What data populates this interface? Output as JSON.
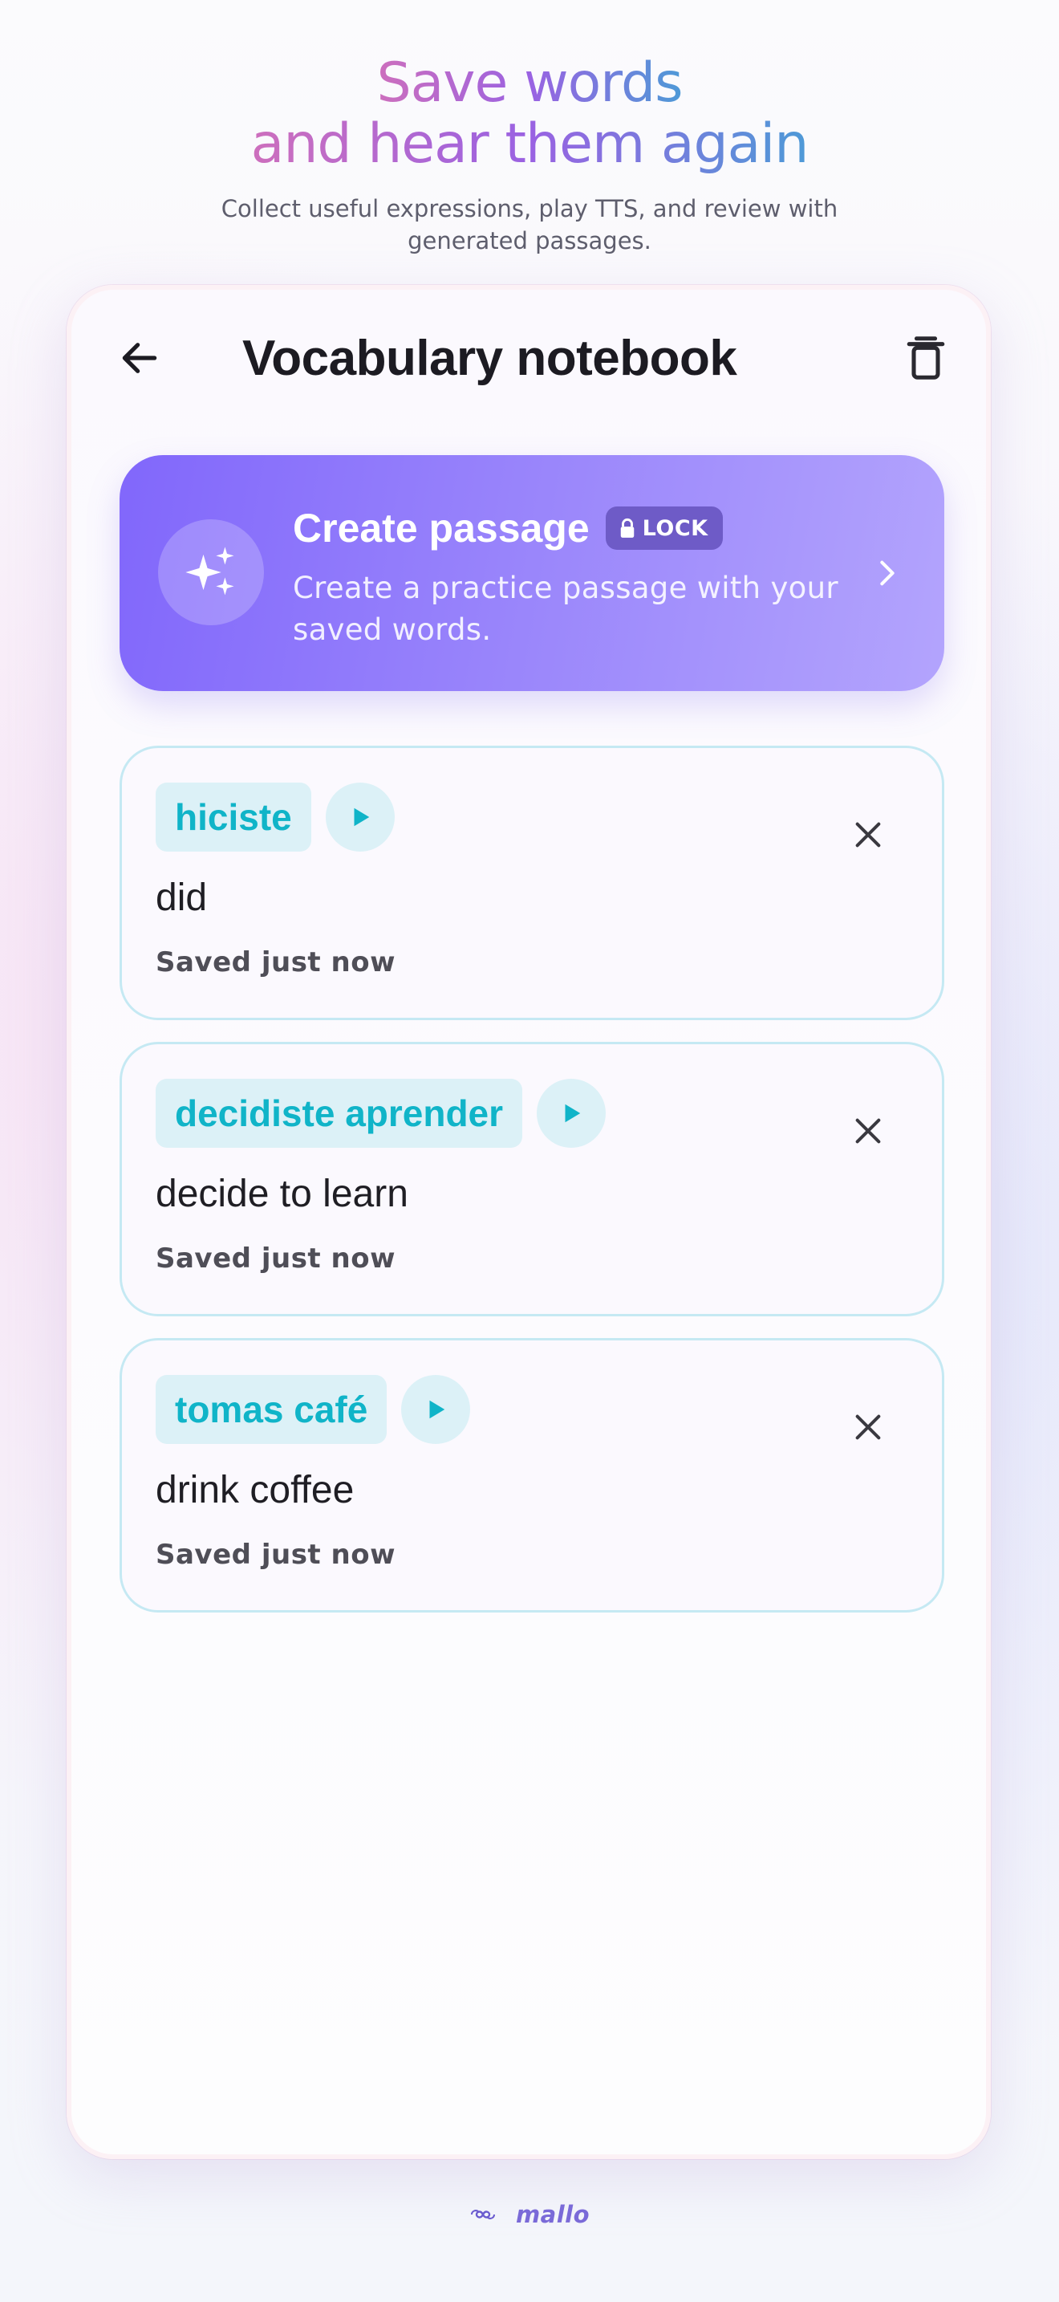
{
  "hero": {
    "title_line1": "Save words",
    "title_line2": "and hear them again",
    "subtitle": "Collect useful expressions, play TTS, and review with generated passages."
  },
  "app": {
    "title": "Vocabulary notebook",
    "back_icon": "arrow-left-icon",
    "trash_icon": "trash-icon"
  },
  "banner": {
    "title": "Create passage",
    "badge": "LOCK",
    "description": "Create a practice passage with your saved words.",
    "icon": "sparkles-icon",
    "chevron_icon": "chevron-right-icon"
  },
  "words": [
    {
      "term": "hiciste",
      "meaning": "did",
      "saved": "Saved just now"
    },
    {
      "term": "decidiste aprender",
      "meaning": "decide to learn",
      "saved": "Saved just now"
    },
    {
      "term": "tomas café",
      "meaning": "drink coffee",
      "saved": "Saved just now"
    }
  ],
  "footer": {
    "logo": "mallo"
  },
  "colors": {
    "accent_purple": "#8167fb",
    "term_teal": "#10b4c8",
    "chip_bg": "#dcf1f7",
    "card_border": "#c5e9f3"
  }
}
